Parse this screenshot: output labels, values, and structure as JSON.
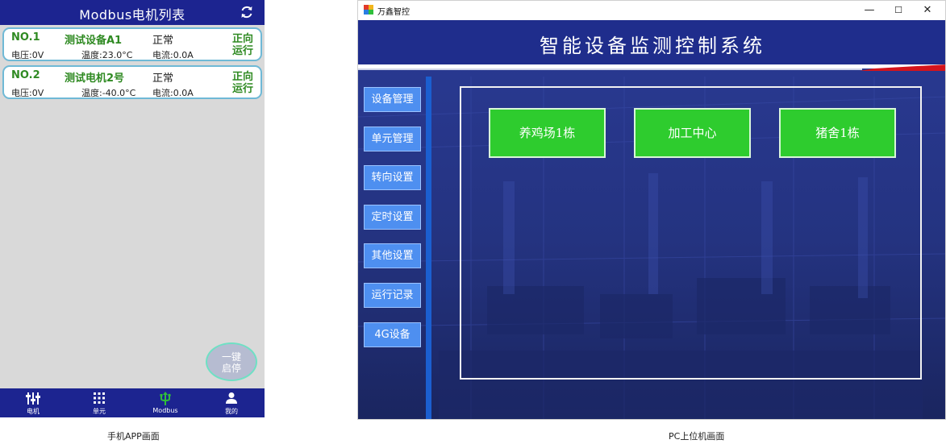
{
  "phone": {
    "title": "Modbus电机列表",
    "devices": [
      {
        "no": "NO.1",
        "name": "测试设备A1",
        "status": "正常",
        "run_line1": "正向",
        "run_line2": "运行",
        "voltage": "电压:0V",
        "temperature": "温度:23.0°C",
        "current": "电流:0.0A"
      },
      {
        "no": "NO.2",
        "name": "测试电机2号",
        "status": "正常",
        "run_line1": "正向",
        "run_line2": "运行",
        "voltage": "电压:0V",
        "temperature": "温度:-40.0°C",
        "current": "电流:0.0A"
      }
    ],
    "fab_line1": "一键",
    "fab_line2": "启停",
    "nav": [
      {
        "label": "电机",
        "icon": "motor-icon"
      },
      {
        "label": "单元",
        "icon": "grid-icon"
      },
      {
        "label": "Modbus",
        "icon": "modbus-icon"
      },
      {
        "label": "我的",
        "icon": "user-icon"
      }
    ],
    "active_nav_color": "#2fbf3a"
  },
  "captions": {
    "app": "手机APP画面",
    "pc": "PC上位机画面"
  },
  "pc": {
    "window_title": "万鑫智控",
    "window_buttons": {
      "minimize": "—",
      "maximize": "☐",
      "close": "✕"
    },
    "system_title": "智能设备监测控制系统",
    "menu": [
      "设备管理",
      "单元管理",
      "转向设置",
      "定时设置",
      "其他设置",
      "运行记录",
      "4G设备"
    ],
    "zones": [
      "养鸡场1栋",
      "加工中心",
      "猪舍1栋"
    ],
    "colors": {
      "background": "#23307a",
      "menu_button": "#4e8ff0",
      "zone_button": "#2ecc2e",
      "accent_red": "#d4141c"
    }
  }
}
